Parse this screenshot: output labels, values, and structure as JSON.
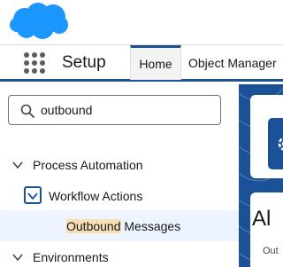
{
  "header": {
    "logo_icon": "cloud-logo-icon",
    "brand_color": "#1b96ff"
  },
  "context_bar": {
    "app_launcher_icon": "app-launcher-grid-icon",
    "app_name": "Setup",
    "tabs": [
      {
        "label": "Home",
        "active": true
      },
      {
        "label": "Object Manager",
        "active": false
      }
    ],
    "accent_color": "#1b5297"
  },
  "sidebar": {
    "search": {
      "icon": "search-icon",
      "value": "outbound"
    },
    "tree": {
      "process_automation": {
        "label": "Process Automation",
        "expanded": true
      },
      "workflow_actions": {
        "label": "Workflow Actions",
        "expanded": true
      },
      "outbound_messages": {
        "label_match": "Outbound",
        "label_rest": " Messages",
        "selected": true
      },
      "environments": {
        "label": "Environments",
        "expanded": true
      }
    }
  },
  "content": {
    "card_icon": "gear-icon",
    "title_partial": "Al",
    "subtitle_partial": "Out"
  }
}
